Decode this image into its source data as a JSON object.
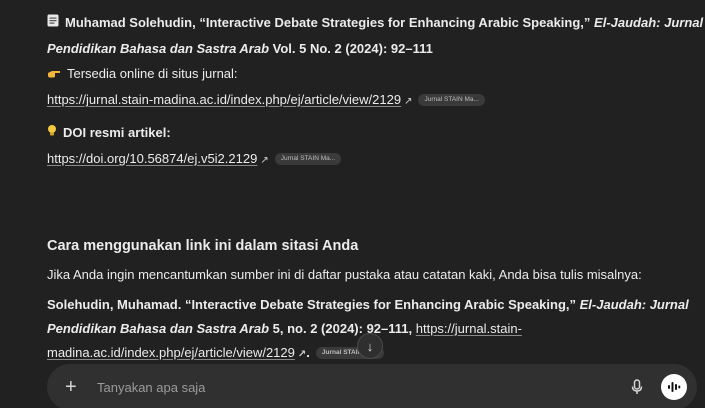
{
  "ref": {
    "icon": "document-icon",
    "text_pre": "Muhamad Solehudin, “Interactive Debate Strategies for Enhancing Arabic Speaking,” ",
    "journal_part1": "El-Jaudah: Jurnal",
    "journal_part2": "Pendidikan Bahasa dan Sastra Arab",
    "text_post": " Vol. 5 No. 2 (2024): 92–111"
  },
  "online": {
    "icon": "pointing-hand-icon",
    "label": "Tersedia online di situs jurnal:",
    "url": "https://jurnal.stain-madina.ac.id/index.php/ej/article/view/2129",
    "arrow": "↗",
    "chip": "Jurnal STAIN Ma..."
  },
  "doi": {
    "icon": "lightbulb-icon",
    "label": "DOI resmi artikel:",
    "url": "https://doi.org/10.56874/ej.v5i2.2129",
    "arrow": "↗",
    "chip": "Jurnal STAIN Ma..."
  },
  "section": {
    "heading": "Cara menggunakan link ini dalam sitasi Anda",
    "intro": "Jika Anda ingin mencantumkan sumber ini di daftar pustaka atau catatan kaki, Anda bisa tulis misalnya:"
  },
  "citation": {
    "text_pre": "Solehudin, Muhamad. “Interactive Debate Strategies for Enhancing Arabic Speaking,” ",
    "journal_part1": "El-Jaudah: Jurnal",
    "journal_part2": "Pendidikan Bahasa dan Sastra Arab",
    "text_mid": " 5, no. 2 (2024): 92–111, ",
    "url_part1": "https://jurnal.stain-",
    "url_part2": "madina.ac.id/index.php/ej/article/view/2129",
    "arrow": "↗",
    "end": ".",
    "chip": "Jurnal STAIN Ma..."
  },
  "scroll_down": {
    "icon": "arrow-down-icon",
    "glyph": "↓"
  },
  "composer": {
    "plus_glyph": "+",
    "placeholder": "Tanyakan apa saja",
    "mic_icon": "microphone-icon",
    "voice_icon": "voice-mode-icon"
  }
}
